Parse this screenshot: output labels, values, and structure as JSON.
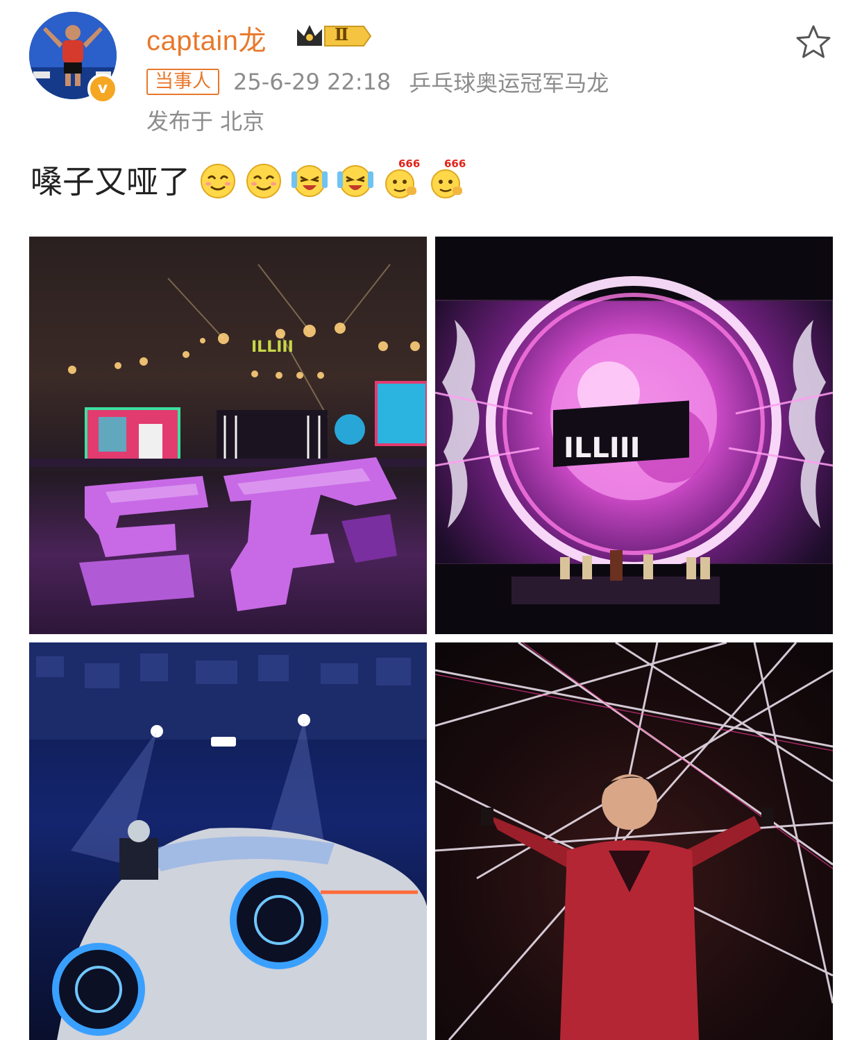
{
  "post": {
    "username": "captain龙",
    "rank_badge": "Ⅱ",
    "verified_mark": "v",
    "tag": "当事人",
    "timestamp": "25-6-29 22:18",
    "source": "乒乓球奥运冠军马龙",
    "location": "发布于 北京",
    "text": "嗓子又哑了",
    "emoji_666": "666"
  },
  "colors": {
    "accent": "#e8782b",
    "meta": "#8c8c8c",
    "text": "#222222",
    "verified": "#f5a623"
  },
  "icons": [
    "star-icon",
    "crown-icon",
    "verified-icon"
  ],
  "photo_texts": {
    "stage_logo": "ILLIII"
  }
}
